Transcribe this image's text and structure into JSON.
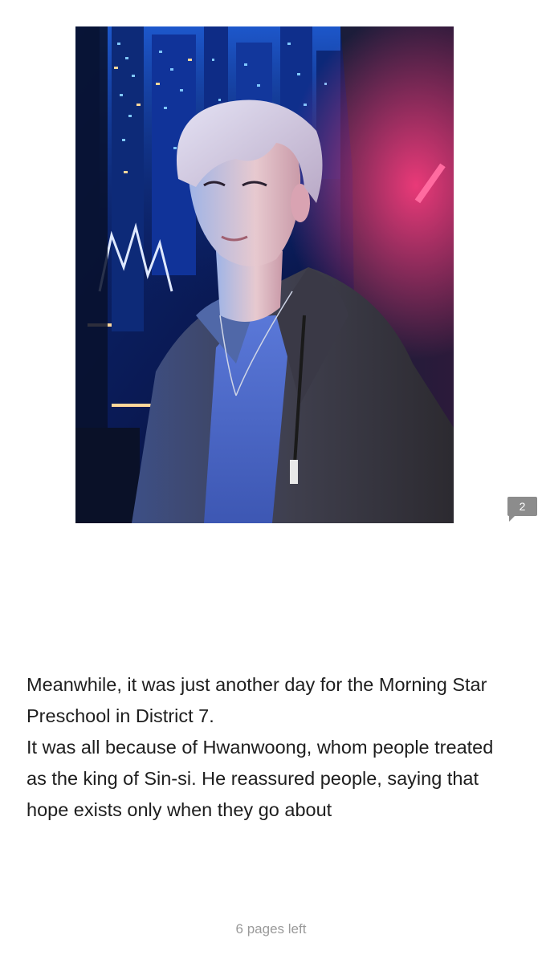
{
  "illustration": {
    "description_icon": "portrait-photo"
  },
  "comment_badge": {
    "count": "2",
    "color": "#8c8c8c"
  },
  "body": {
    "paragraphs": [
      "Meanwhile, it was just another day for the Morning Star Preschool in District 7.",
      "It was all because of Hwanwoong, whom people treated as the king of Sin-si. He reassured people, saying that hope exists only when they go about"
    ]
  },
  "footer": {
    "pages_left": "6 pages left"
  },
  "colors": {
    "text": "#1e1e1e",
    "muted": "#9a9a9a",
    "background": "#ffffff"
  }
}
